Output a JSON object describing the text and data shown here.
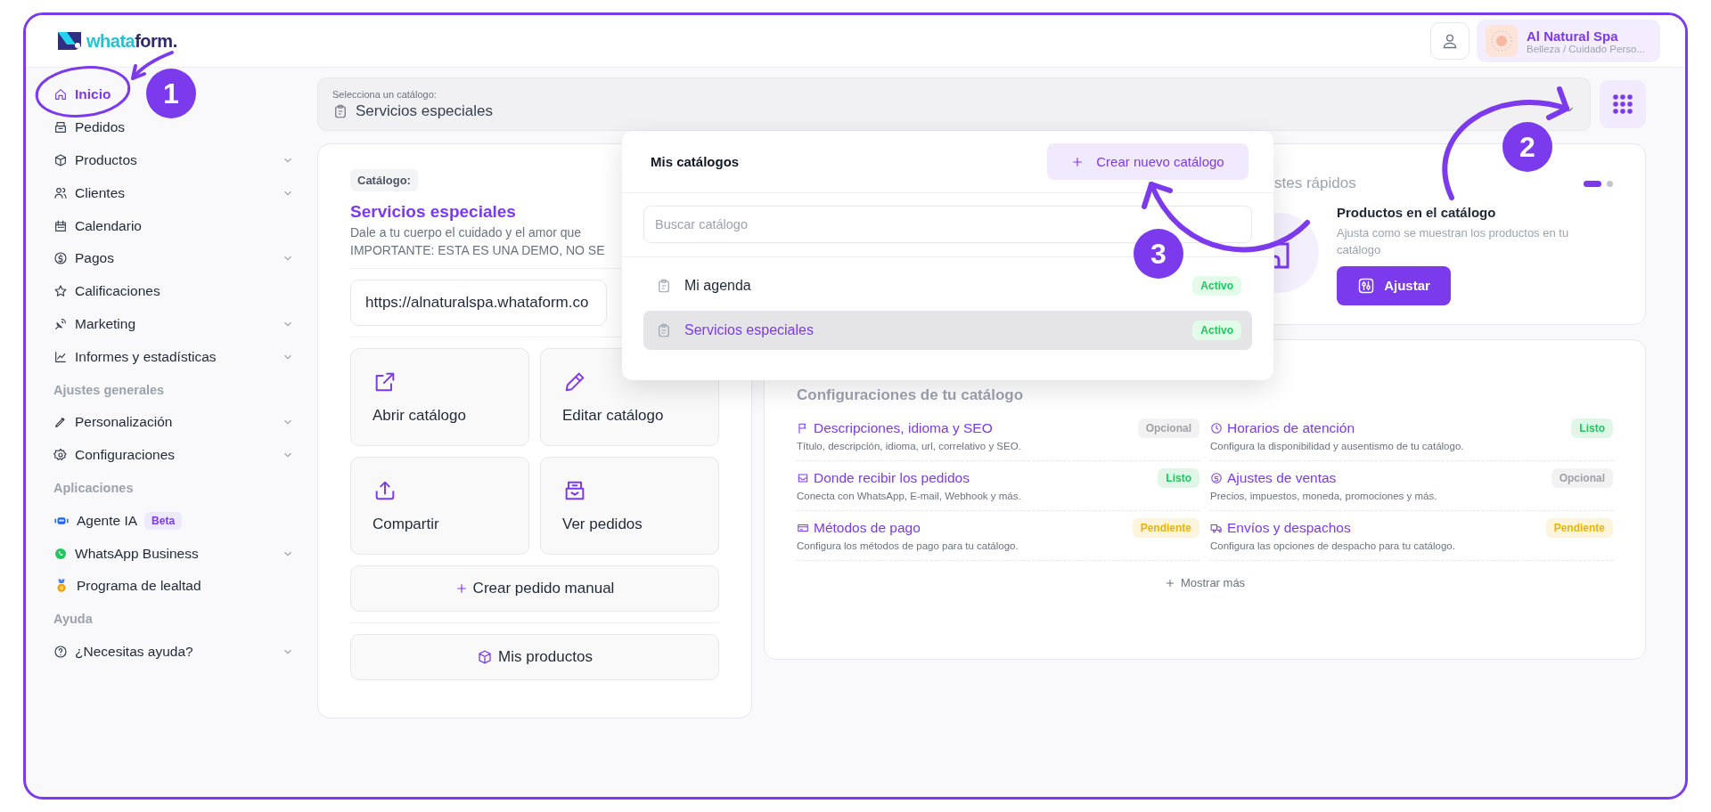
{
  "header": {
    "logo": {
      "part_a": "whata",
      "part_b": "form."
    },
    "account": {
      "name": "Al Natural Spa",
      "category": "Belleza / Cuidado Perso..."
    }
  },
  "sidebar": [
    {
      "kind": "item",
      "label": "Inicio",
      "selected": true,
      "expandable": false
    },
    {
      "kind": "item",
      "label": "Pedidos",
      "selected": false,
      "expandable": false
    },
    {
      "kind": "item",
      "label": "Productos",
      "selected": false,
      "expandable": true
    },
    {
      "kind": "item",
      "label": "Clientes",
      "selected": false,
      "expandable": true
    },
    {
      "kind": "item",
      "label": "Calendario",
      "selected": false,
      "expandable": false
    },
    {
      "kind": "item",
      "label": "Pagos",
      "selected": false,
      "expandable": true
    },
    {
      "kind": "item",
      "label": "Calificaciones",
      "selected": false,
      "expandable": false
    },
    {
      "kind": "item",
      "label": "Marketing",
      "selected": false,
      "expandable": true
    },
    {
      "kind": "item",
      "label": "Informes y estadísticas",
      "selected": false,
      "expandable": true
    },
    {
      "kind": "section",
      "label": "Ajustes generales"
    },
    {
      "kind": "item",
      "label": "Personalización",
      "selected": false,
      "expandable": true
    },
    {
      "kind": "item",
      "label": "Configuraciones",
      "selected": false,
      "expandable": true
    },
    {
      "kind": "section",
      "label": "Aplicaciones"
    },
    {
      "kind": "item",
      "label": "Agente IA",
      "selected": false,
      "expandable": false,
      "badge": "Beta"
    },
    {
      "kind": "item",
      "label": "WhatsApp Business",
      "selected": false,
      "expandable": true
    },
    {
      "kind": "item",
      "label": "Programa de lealtad",
      "selected": false,
      "expandable": false
    },
    {
      "kind": "section",
      "label": "Ayuda"
    },
    {
      "kind": "item",
      "label": "¿Necesitas ayuda?",
      "selected": false,
      "expandable": true
    }
  ],
  "catalog_select": {
    "label": "Selecciona un catálogo:",
    "value": "Servicios especiales"
  },
  "catalog_card": {
    "tag": "Catálogo:",
    "name": "Servicios especiales",
    "description": [
      "Dale a tu cuerpo el cuidado y el amor que",
      "IMPORTANTE: ESTA ES UNA DEMO, NO SE"
    ],
    "url": "https://alnaturalspa.whataform.co",
    "actions": [
      {
        "label": "Abrir catálogo"
      },
      {
        "label": "Editar catálogo"
      },
      {
        "label": "Compartir"
      },
      {
        "label": "Ver pedidos"
      }
    ],
    "create_order": "Crear pedido manual",
    "products": "Mis productos"
  },
  "quick_settings": {
    "title": "stes rápidos",
    "pager": [
      {
        "selected": true
      },
      {
        "selected": false
      }
    ],
    "title_item": "Productos en el catálogo",
    "description": "Ajusta como se muestran los productos en tu catálogo",
    "button": "Ajustar"
  },
  "config": {
    "title": "Configuraciones de tu catálogo",
    "items": [
      {
        "title": "Descripciones, idioma y SEO",
        "description": "Título, descripción, idioma, url, correlativo y SEO.",
        "status": "Opcional",
        "color": "#a1a1aa"
      },
      {
        "title": "Horarios de atención",
        "description": "Configura la disponibilidad y ausentismo de tu catálogo.",
        "status": "Listo",
        "color": "#22c55e"
      },
      {
        "title": "Donde recibir los pedidos",
        "description": "Conecta con WhatsApp, E-mail, Webhook y más.",
        "status": "Listo",
        "color": "#22c55e"
      },
      {
        "title": "Ajustes de ventas",
        "description": "Precios, impuestos, moneda, promociones y más.",
        "status": "Opcional",
        "color": "#a1a1aa"
      },
      {
        "title": "Métodos de pago",
        "description": "Configura los métodos de pago para tu catálogo.",
        "status": "Pendiente",
        "color": "#eab308"
      },
      {
        "title": "Envíos y despachos",
        "description": "Configura las opciones de despacho para tu catálogo.",
        "status": "Pendiente",
        "color": "#eab308"
      }
    ],
    "more": "Mostrar más"
  },
  "dropdown": {
    "title": "Mis catálogos",
    "create_button": "Crear nuevo catálogo",
    "search_placeholder": "Buscar catálogo",
    "catalogs": [
      {
        "name": "Mi agenda",
        "status": "Activo",
        "selected": false
      },
      {
        "name": "Servicios especiales",
        "status": "Activo",
        "selected": true
      }
    ]
  },
  "annotations": [
    {
      "number": "1"
    },
    {
      "number": "2"
    },
    {
      "number": "3"
    }
  ]
}
